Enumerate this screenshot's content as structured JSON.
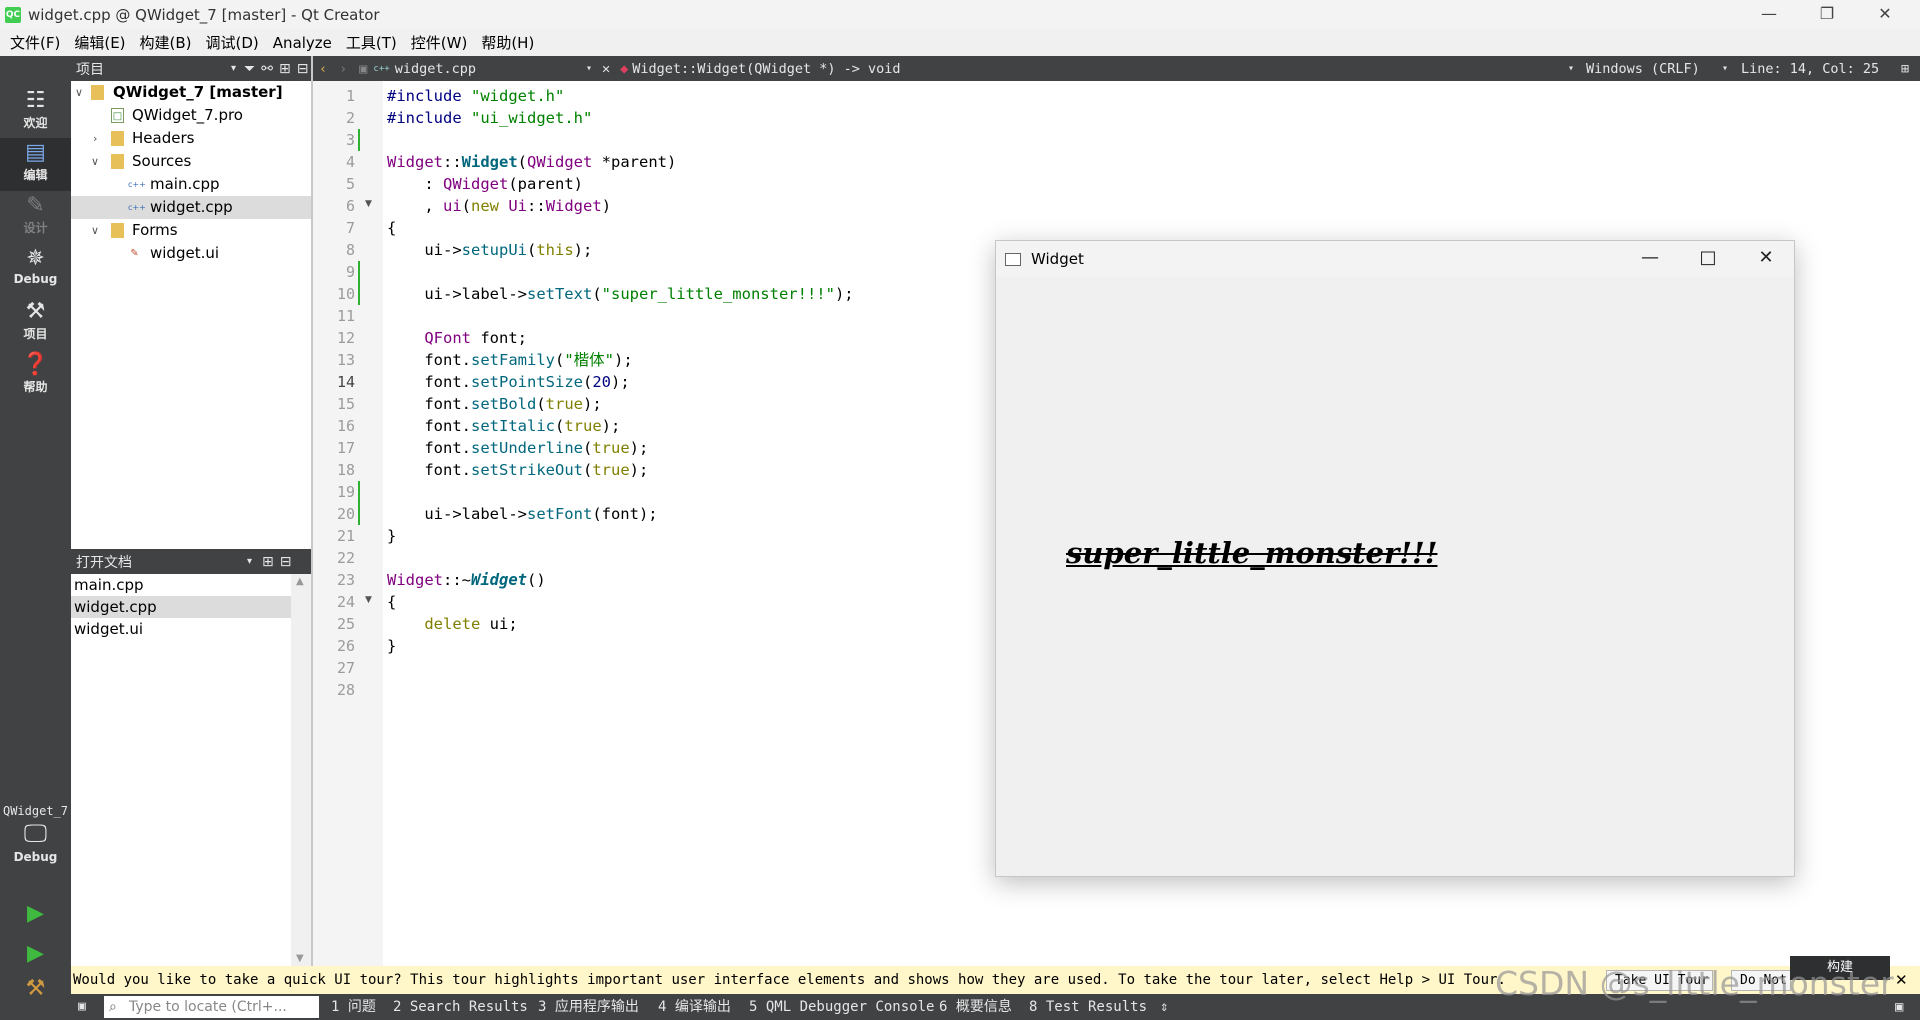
{
  "window": {
    "title": "widget.cpp @ QWidget_7 [master] - Qt Creator",
    "app_icon": "QC"
  },
  "menu": [
    "文件(F)",
    "编辑(E)",
    "构建(B)",
    "调试(D)",
    "Analyze",
    "工具(T)",
    "控件(W)",
    "帮助(H)"
  ],
  "modes": [
    {
      "label": "欢迎",
      "icon": "grid-icon"
    },
    {
      "label": "编辑",
      "icon": "document-icon"
    },
    {
      "label": "设计",
      "icon": "pencil-icon"
    },
    {
      "label": "Debug",
      "icon": "bug-icon"
    },
    {
      "label": "项目",
      "icon": "wrench-icon"
    },
    {
      "label": "帮助",
      "icon": "help-icon"
    }
  ],
  "kit": {
    "project": "QWidget_7",
    "config": "Debug"
  },
  "project_panel": {
    "title": "项目"
  },
  "tree": {
    "root": "QWidget_7 [master]",
    "pro": "QWidget_7.pro",
    "headers": "Headers",
    "sources": "Sources",
    "main": "main.cpp",
    "widget": "widget.cpp",
    "forms": "Forms",
    "ui": "widget.ui"
  },
  "open_docs": {
    "title": "打开文档",
    "items": [
      "main.cpp",
      "widget.cpp",
      "widget.ui"
    ]
  },
  "editor_toolbar": {
    "file": "widget.cpp",
    "symbol": "Widget::Widget(QWidget *) -> void",
    "encoding": "Windows (CRLF)",
    "position": "Line: 14, Col: 25"
  },
  "code": {
    "l1a": "#include ",
    "l1b": "\"widget.h\"",
    "l2a": "#include ",
    "l2b": "\"ui_widget.h\"",
    "l4a": "Widget",
    "l4b": "::",
    "l4c": "Widget",
    "l4d": "(",
    "l4e": "QWidget",
    "l4f": " *parent)",
    "l5a": "    : ",
    "l5b": "QWidget",
    "l5c": "(parent)",
    "l6a": "    , ",
    "l6b": "ui",
    "l6c": "(",
    "l6d": "new ",
    "l6e": "Ui",
    "l6f": "::",
    "l6g": "Widget",
    "l6h": ")",
    "l7": "{",
    "l8a": "    ui->",
    "l8b": "setupUi",
    "l8c": "(",
    "l8d": "this",
    "l8e": ");",
    "l10a": "    ui->label->",
    "l10b": "setText",
    "l10c": "(",
    "l10d": "\"super_little_monster!!!\"",
    "l10e": ");",
    "l12a": "    ",
    "l12b": "QFont",
    "l12c": " font;",
    "l13a": "    font.",
    "l13b": "setFamily",
    "l13c": "(",
    "l13d": "\"楷体\"",
    "l13e": ");",
    "l14a": "    font.",
    "l14b": "setPointSize",
    "l14c": "(",
    "l14d": "20",
    "l14e": ");",
    "l15a": "    font.",
    "l15b": "setBold",
    "l15c": "(",
    "l15d": "true",
    "l15e": ");",
    "l16a": "    font.",
    "l16b": "setItalic",
    "l16c": "(",
    "l16d": "true",
    "l16e": ");",
    "l17a": "    font.",
    "l17b": "setUnderline",
    "l17c": "(",
    "l17d": "true",
    "l17e": ");",
    "l18a": "    font.",
    "l18b": "setStrikeOut",
    "l18c": "(",
    "l18d": "true",
    "l18e": ");",
    "l20a": "    ui->label->",
    "l20b": "setFont",
    "l20c": "(font);",
    "l21": "}",
    "l23a": "Widget",
    "l23b": "::~",
    "l23c": "Widget",
    "l23d": "()",
    "l24": "{",
    "l25a": "    ",
    "l25b": "delete ",
    "l25c": "ui;",
    "l26": "}"
  },
  "lines": [
    "1",
    "2",
    "3",
    "4",
    "5",
    "6",
    "7",
    "8",
    "9",
    "10",
    "11",
    "12",
    "13",
    "14",
    "15",
    "16",
    "17",
    "18",
    "19",
    "20",
    "21",
    "22",
    "23",
    "24",
    "25",
    "26",
    "27",
    "28"
  ],
  "widget_window": {
    "title": "Widget",
    "label": "super_little_monster!!!"
  },
  "tour": {
    "message": "Would you like to take a quick UI tour? This tour highlights important user interface elements and shows how they are used. To take the tour later, select Help > UI Tour.",
    "take": "Take UI Tour",
    "dont": "Do Not Show Again"
  },
  "build_popup": "构建",
  "statusbar": {
    "locate_placeholder": "Type to locate (Ctrl+...",
    "panes": [
      "1 问题",
      "2 Search Results",
      "3 应用程序输出",
      "4 编译输出",
      "5 QML Debugger Console",
      "6 概要信息",
      "8 Test Results"
    ]
  },
  "watermark": "CSDN @s_little_monster"
}
